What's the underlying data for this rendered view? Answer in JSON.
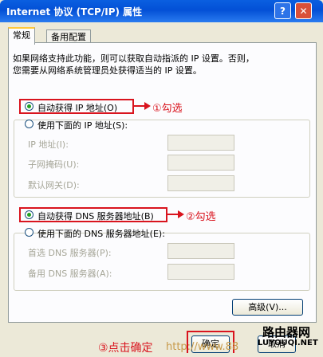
{
  "window": {
    "title": "Internet 协议 (TCP/IP) 属性",
    "help_glyph": "?",
    "close_glyph": "✕"
  },
  "tabs": [
    {
      "label": "常规"
    },
    {
      "label": "备用配置"
    }
  ],
  "description": [
    "如果网络支持此功能，则可以获取自动指派的 IP 设置。否则，",
    "您需要从网络系统管理员处获得适当的 IP 设置。"
  ],
  "ip_section": {
    "auto_label": "自动获得 IP 地址(O)",
    "manual_label": "使用下面的 IP 地址(S):",
    "selected": "auto",
    "fields": [
      {
        "label": "IP 地址(I):",
        "value": ""
      },
      {
        "label": "子网掩码(U):",
        "value": ""
      },
      {
        "label": "默认网关(D):",
        "value": ""
      }
    ]
  },
  "dns_section": {
    "auto_label": "自动获得 DNS 服务器地址(B)",
    "manual_label": "使用下面的 DNS 服务器地址(E):",
    "selected": "auto",
    "fields": [
      {
        "label": "首选 DNS 服务器(P):",
        "value": ""
      },
      {
        "label": "备用 DNS 服务器(A):",
        "value": ""
      }
    ]
  },
  "buttons": {
    "advanced": "高级(V)...",
    "ok": "确定",
    "cancel": "取消"
  },
  "annotations": {
    "step1": "①勾选",
    "step2": "②勾选",
    "step3": "③点击确定"
  },
  "watermark": {
    "brand": "路由器网",
    "url": "http://www.88",
    "domain": "LUYOUQI.NET"
  },
  "colors": {
    "annotation_red": "#d9141e",
    "titlebar_blue": "#0a5fe0",
    "dialog_bg": "#ece9d8"
  }
}
